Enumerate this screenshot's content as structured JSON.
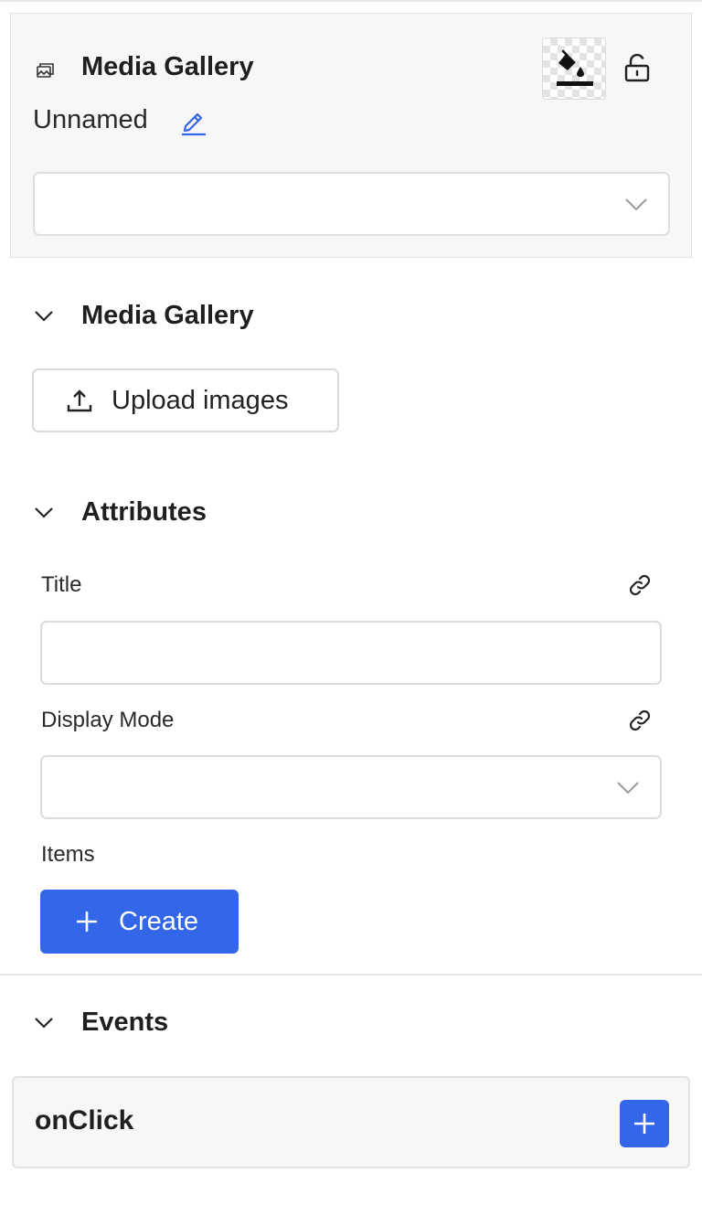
{
  "header": {
    "component_type": "Media Gallery",
    "component_icon": "gallery-icon",
    "name": "Unnamed",
    "edit_icon": "pencil-icon",
    "background_icon": "paint-bucket-icon",
    "lock_icon": "unlock-icon",
    "style_select": {
      "value": ""
    }
  },
  "sections": {
    "media_gallery": {
      "title": "Media Gallery",
      "upload_label": "Upload images",
      "upload_icon": "upload-icon"
    },
    "attributes": {
      "title": "Attributes",
      "fields": {
        "title": {
          "label": "Title",
          "value": ""
        },
        "display_mode": {
          "label": "Display Mode",
          "value": ""
        },
        "items": {
          "label": "Items"
        }
      },
      "create_label": "Create",
      "link_icon": "link-icon"
    },
    "events": {
      "title": "Events",
      "items": [
        {
          "name": "onClick"
        }
      ],
      "add_icon": "plus-icon"
    }
  },
  "colors": {
    "accent": "#3366e8",
    "panel_bg": "#f7f7f7",
    "border": "#dcdcdc"
  }
}
